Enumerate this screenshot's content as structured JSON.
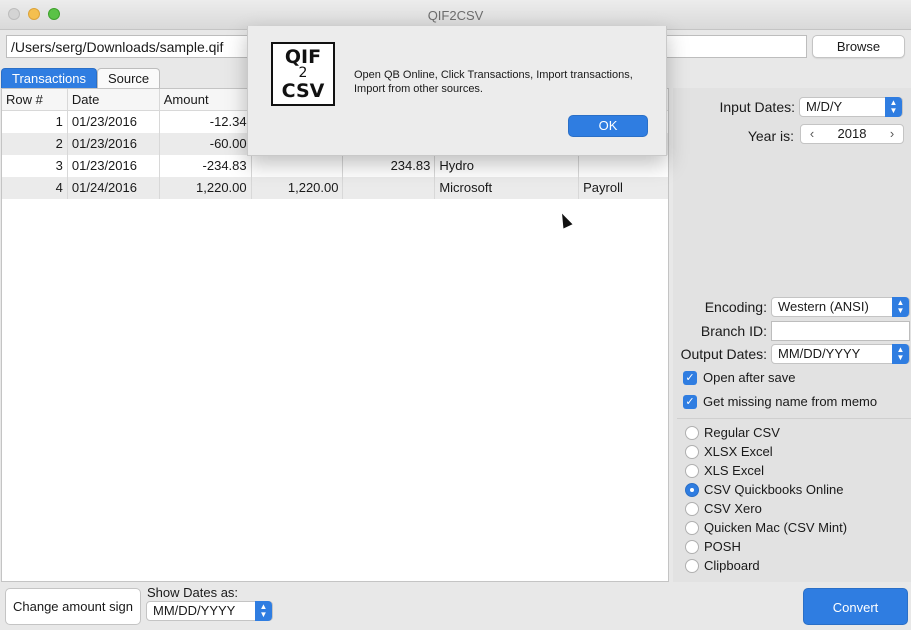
{
  "window": {
    "title": "QIF2CSV"
  },
  "file": {
    "path": "/Users/serg/Downloads/sample.qif",
    "browse_label": "Browse"
  },
  "tabs": [
    {
      "label": "Transactions"
    },
    {
      "label": "Source"
    }
  ],
  "table": {
    "headers": [
      "Row #",
      "Date",
      "Amount",
      "",
      "",
      "",
      ""
    ],
    "rows": [
      [
        "1",
        "01/23/2016",
        "-12.34",
        "",
        "",
        "",
        ""
      ],
      [
        "2",
        "01/23/2016",
        "-60.00",
        "",
        "",
        "",
        ""
      ],
      [
        "3",
        "01/23/2016",
        "-234.83",
        "",
        "234.83",
        "Hydro",
        ""
      ],
      [
        "4",
        "01/24/2016",
        "1,220.00",
        "1,220.00",
        "",
        "Microsoft",
        "Payroll"
      ]
    ]
  },
  "settings": {
    "input_dates_label": "Input Dates:",
    "input_dates_value": "M/D/Y",
    "year_label": "Year is:",
    "year_value": "2018",
    "encoding_label": "Encoding:",
    "encoding_value": "Western (ANSI)",
    "branch_label": "Branch ID:",
    "branch_value": "",
    "output_dates_label": "Output Dates:",
    "output_dates_value": "MM/DD/YYYY",
    "open_after_save": "Open after save",
    "get_missing_name": "Get missing name from memo"
  },
  "formats": [
    {
      "label": "Regular CSV",
      "selected": false
    },
    {
      "label": "XLSX Excel",
      "selected": false
    },
    {
      "label": "XLS Excel",
      "selected": false
    },
    {
      "label": "CSV Quickbooks Online",
      "selected": true
    },
    {
      "label": "CSV Xero",
      "selected": false
    },
    {
      "label": "Quicken Mac (CSV Mint)",
      "selected": false
    },
    {
      "label": "POSH",
      "selected": false
    },
    {
      "label": "Clipboard",
      "selected": false
    }
  ],
  "bottom": {
    "change_sign_label": "Change amount sign",
    "show_dates_label": "Show Dates as:",
    "show_dates_value": "MM/DD/YYYY",
    "convert_label": "Convert"
  },
  "modal": {
    "logo_line1": "QIF",
    "logo_line2": "2",
    "logo_line3": "CSV",
    "message": "Open QB Online, Click Transactions, Import transactions, Import from other sources.",
    "ok_label": "OK"
  },
  "colors": {
    "accent": "#2f7de1"
  }
}
